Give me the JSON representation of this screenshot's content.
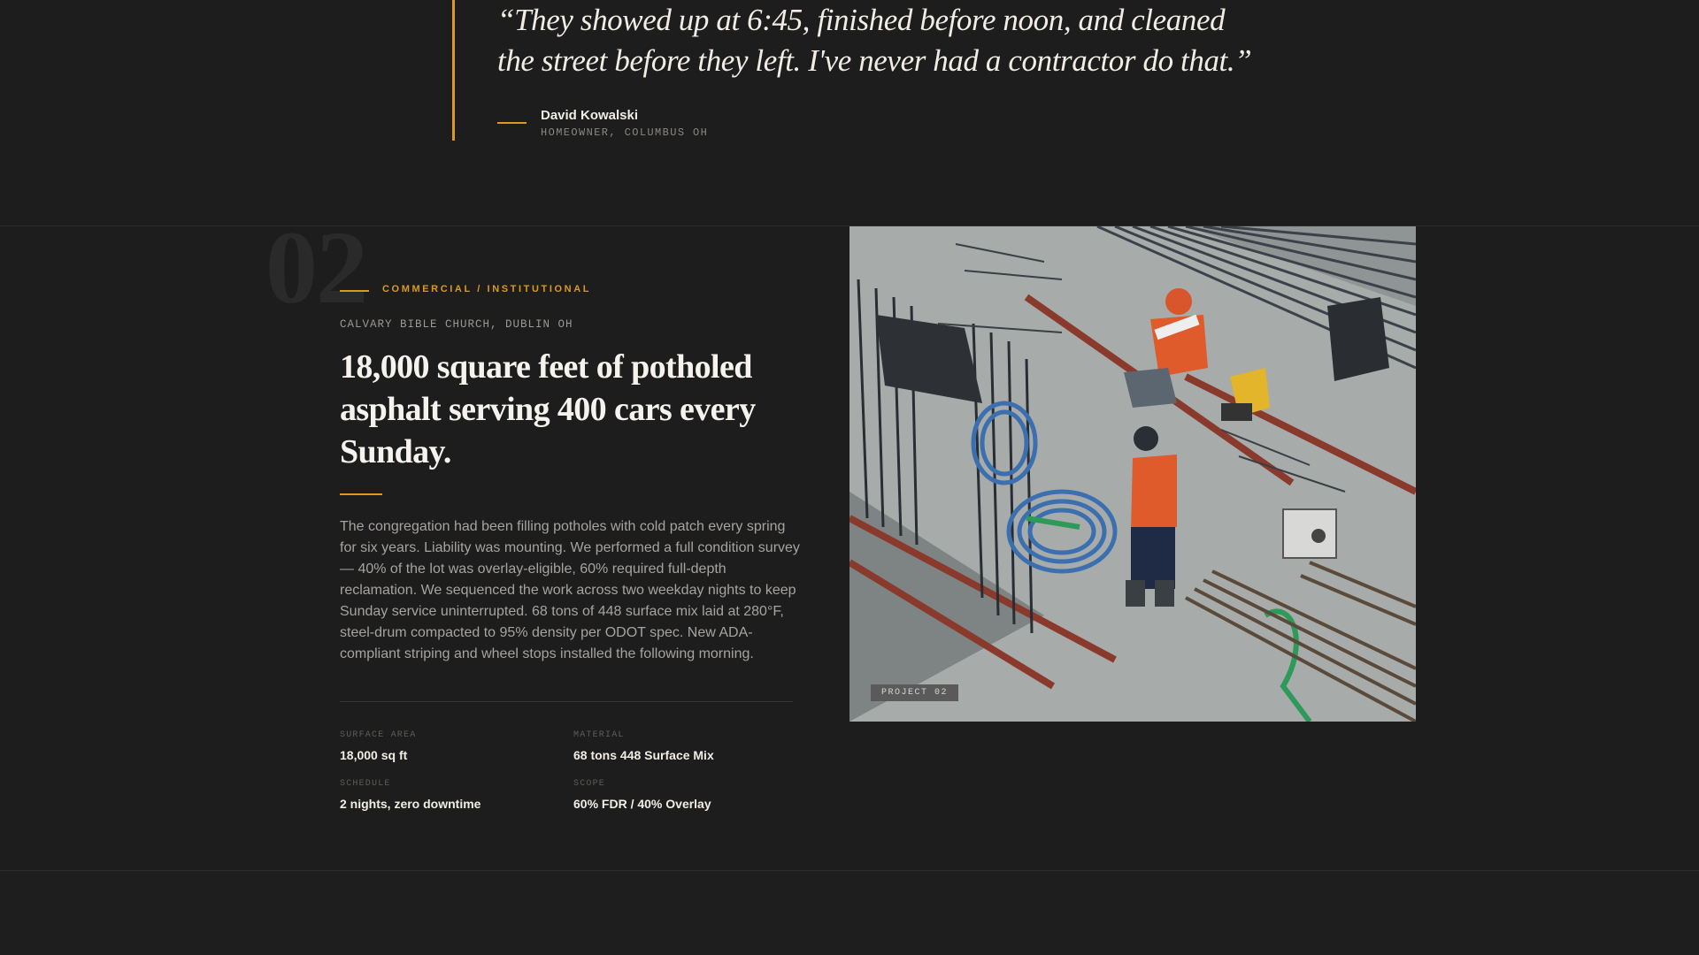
{
  "testimonial": {
    "quote": "“They showed up at 6:45, finished before noon, and cleaned the street before they left. I've never had a contractor do that.”",
    "author": "David Kowalski",
    "role": "HOMEOWNER, COLUMBUS OH"
  },
  "project": {
    "number": "02",
    "category": "COMMERCIAL / INSTITUTIONAL",
    "client": "CALVARY BIBLE CHURCH, DUBLIN OH",
    "headline": "18,000 square feet of potholed asphalt serving 400 cars every Sunday.",
    "body": "The congregation had been filling potholes with cold patch every spring for six years. Liability was mounting. We performed a full condition survey — 40% of the lot was overlay-eligible, 60% required full-depth reclamation. We sequenced the work across two weekday nights to keep Sunday service uninterrupted. 68 tons of 448 surface mix laid at 280°F, steel-drum compacted to 95% density per ODOT spec. New ADA-compliant striping and wheel stops installed the following morning.",
    "stats": [
      {
        "label": "SURFACE AREA",
        "value": "18,000 sq ft"
      },
      {
        "label": "MATERIAL",
        "value": "68 tons 448 Surface Mix"
      },
      {
        "label": "SCHEDULE",
        "value": "2 nights, zero downtime"
      },
      {
        "label": "SCOPE",
        "value": "60% FDR / 40% Overlay"
      }
    ],
    "image_tag": "PROJECT 02"
  },
  "colors": {
    "background": "#1d1d1d",
    "accent": "#d99a1e",
    "text_primary": "#f1ede6",
    "text_muted": "#a6a4a0"
  }
}
